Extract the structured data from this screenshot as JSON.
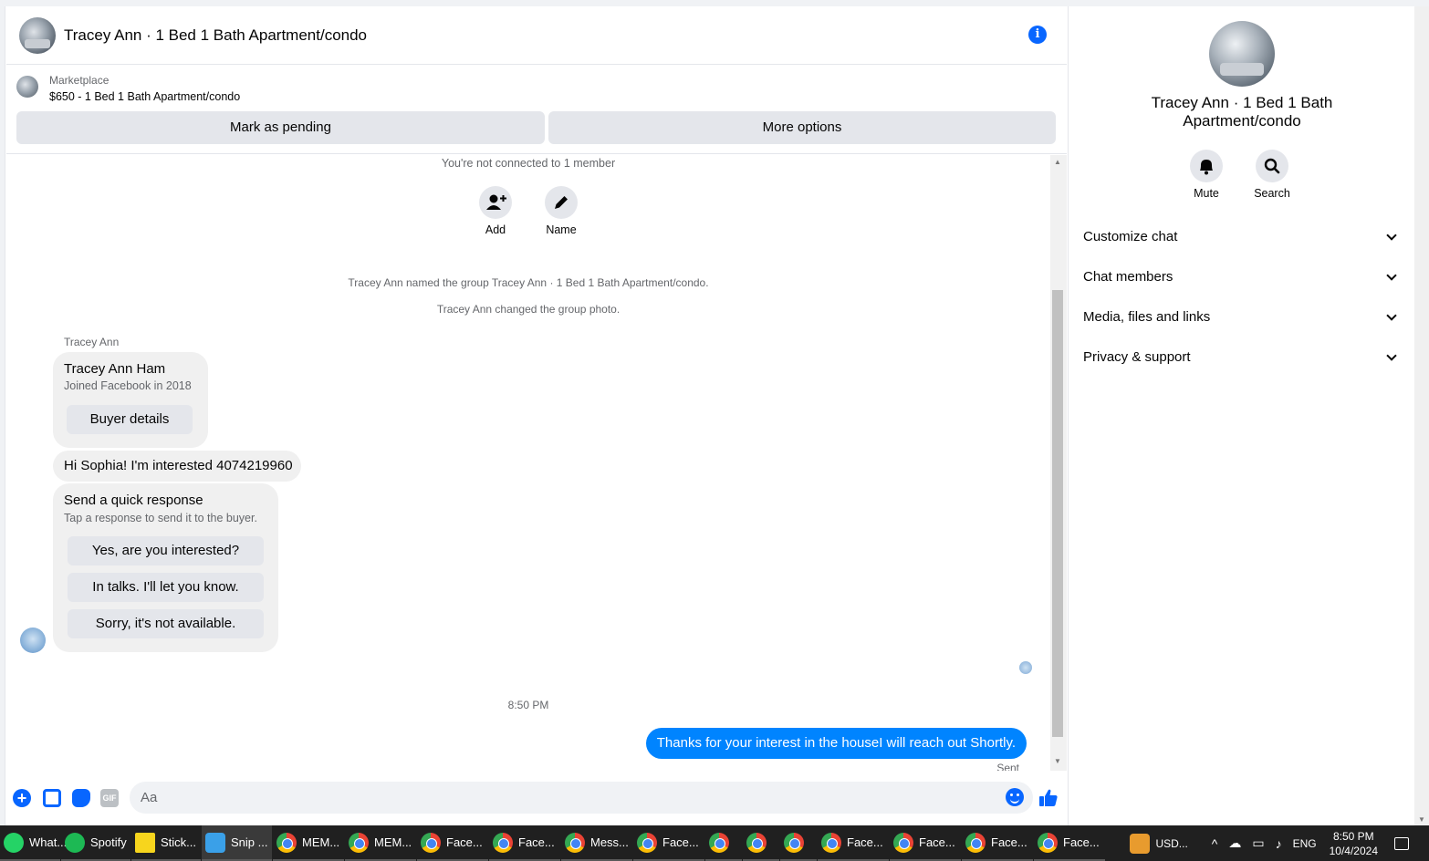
{
  "header": {
    "title": "Tracey Ann · 1 Bed 1 Bath Apartment/condo"
  },
  "listing": {
    "source": "Marketplace",
    "name": "$650 - 1 Bed 1 Bath Apartment/condo",
    "pending_label": "Mark as pending",
    "more_label": "More options"
  },
  "messages": {
    "not_connected": "You're not connected to 1 member",
    "add_label": "Add",
    "name_label": "Name",
    "system_named": "Tracey Ann named the group Tracey Ann · 1 Bed 1 Bath Apartment/condo.",
    "system_photo": "Tracey Ann changed the group photo.",
    "sender": "Tracey Ann",
    "profile_card": {
      "name": "Tracey Ann Ham",
      "joined": "Joined Facebook in 2018",
      "button": "Buyer details"
    },
    "incoming_text": "Hi Sophia! I'm interested 4074219960",
    "quick_response": {
      "title": "Send a quick response",
      "subtitle": "Tap a response to send it to the buyer.",
      "options": [
        "Yes, are you interested?",
        "In talks. I'll let you know.",
        "Sorry, it's not available."
      ]
    },
    "timestamp": "8:50 PM",
    "outgoing_text": "Thanks for your interest in the houseI will reach out Shortly.",
    "status": "Sent"
  },
  "composer": {
    "placeholder": "Aa",
    "gif_label": "GIF"
  },
  "panel": {
    "title": "Tracey Ann · 1 Bed 1 Bath Apartment/condo",
    "mute_label": "Mute",
    "search_label": "Search",
    "rows": [
      "Customize chat",
      "Chat members",
      "Media, files and links",
      "Privacy & support"
    ]
  },
  "taskbar": {
    "items": [
      "What...",
      "Spotify",
      "Stick...",
      "Snip ...",
      "MEM...",
      "MEM...",
      "Face...",
      "Face...",
      "Mess...",
      "Face...",
      "Face...",
      "Face...",
      "Face...",
      "Face..."
    ],
    "currency": "USD...",
    "lang": "ENG",
    "time": "8:50 PM",
    "date": "10/4/2024"
  }
}
